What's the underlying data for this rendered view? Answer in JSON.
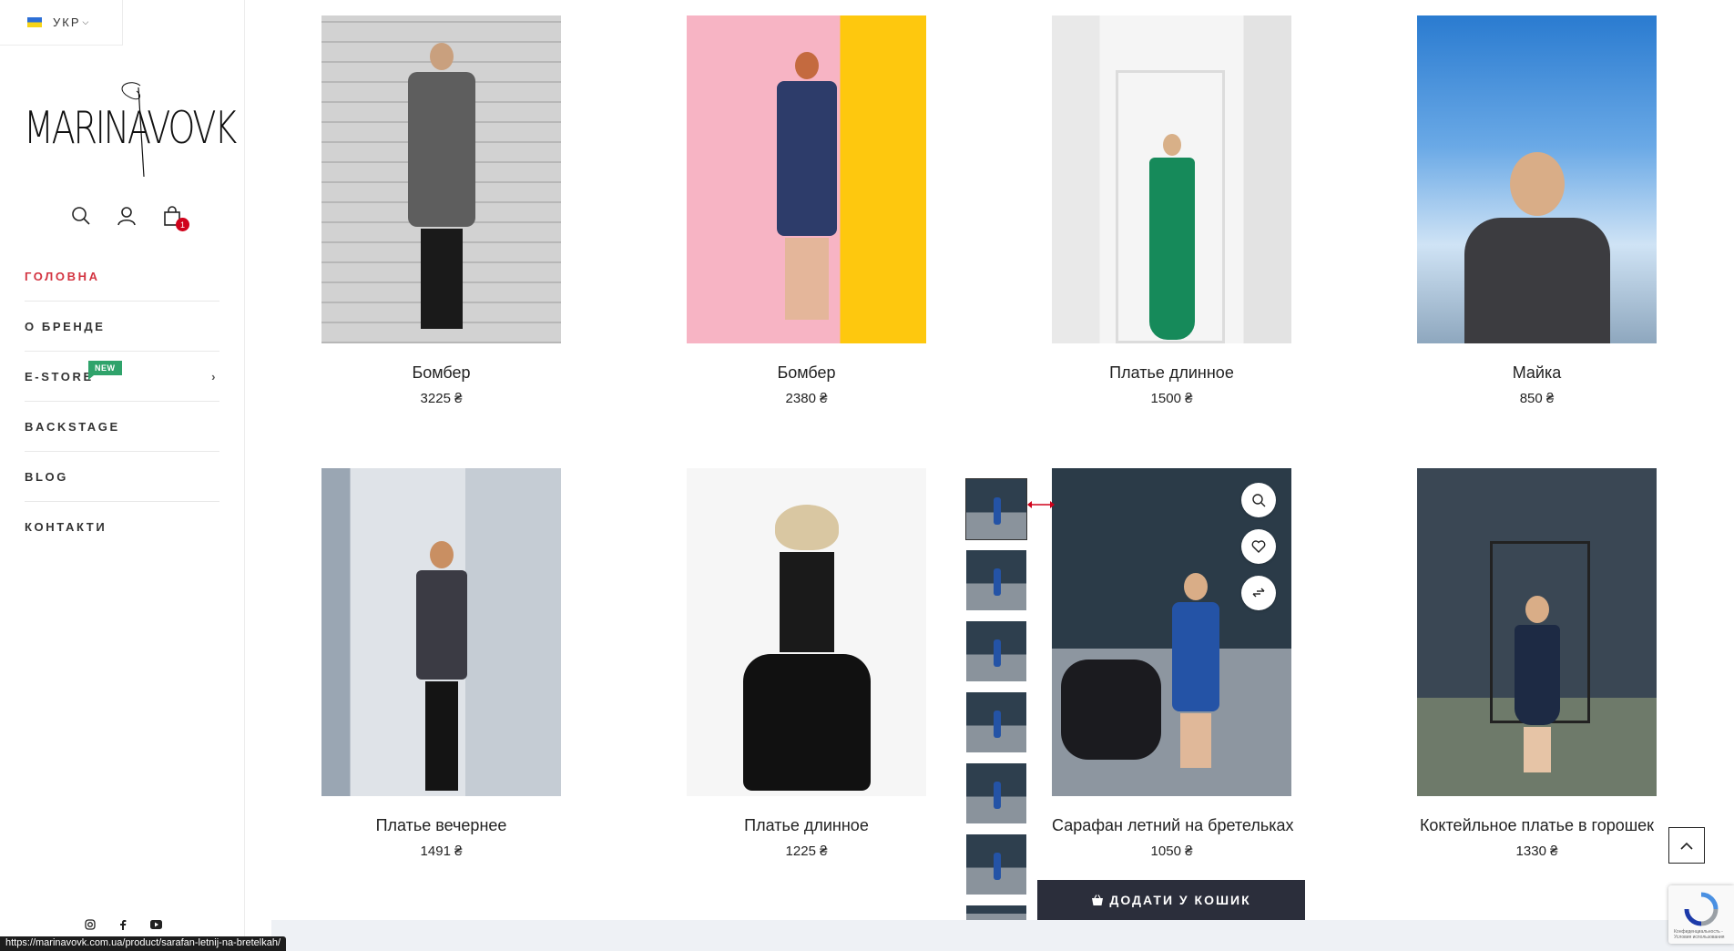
{
  "language": {
    "code": "УКР",
    "flag": "ukraine-flag"
  },
  "brand": {
    "logo_text": "MARINAVOVK"
  },
  "header_icons": {
    "search": "search-icon",
    "account": "user-icon",
    "cart": "shopping-bag-icon",
    "cart_count": "1"
  },
  "nav": {
    "items": [
      {
        "label": "ГОЛОВНА",
        "active": true
      },
      {
        "label": "О БРЕНДЕ"
      },
      {
        "label": "E-STORE",
        "badge": "NEW",
        "has_submenu": true
      },
      {
        "label": "BACKSTAGE"
      },
      {
        "label": "BLOG"
      },
      {
        "label": "КОНТАКТИ"
      }
    ],
    "chevron": "›"
  },
  "social": [
    "instagram-icon",
    "facebook-icon",
    "youtube-icon"
  ],
  "products": [
    {
      "name": "Бомбер",
      "price": "3225 ₴"
    },
    {
      "name": "Бомбер",
      "price": "2380 ₴"
    },
    {
      "name": "Платье длинное",
      "price": "1500 ₴"
    },
    {
      "name": "Майка",
      "price": "850 ₴"
    },
    {
      "name": "Платье вечернее",
      "price": "1491 ₴"
    },
    {
      "name": "Платье длинное",
      "price": "1225 ₴"
    },
    {
      "name": "Сарафан летний на бретельках",
      "price": "1050 ₴"
    },
    {
      "name": "Коктейльное платье в горошек",
      "price": "1330 ₴"
    }
  ],
  "quick_actions": [
    "search-icon",
    "heart-icon",
    "compare-icon"
  ],
  "add_to_cart_label": "ДОДАТИ У КОШИК",
  "status_url": "https://marinavovk.com.ua/product/sarafan-letnij-na-bretelkah/",
  "recaptcha_text": "Конфиденциальность - Условия использования",
  "colors": {
    "accent": "#d33441",
    "badge": "#2fa36b",
    "button": "#2b2e3b"
  }
}
